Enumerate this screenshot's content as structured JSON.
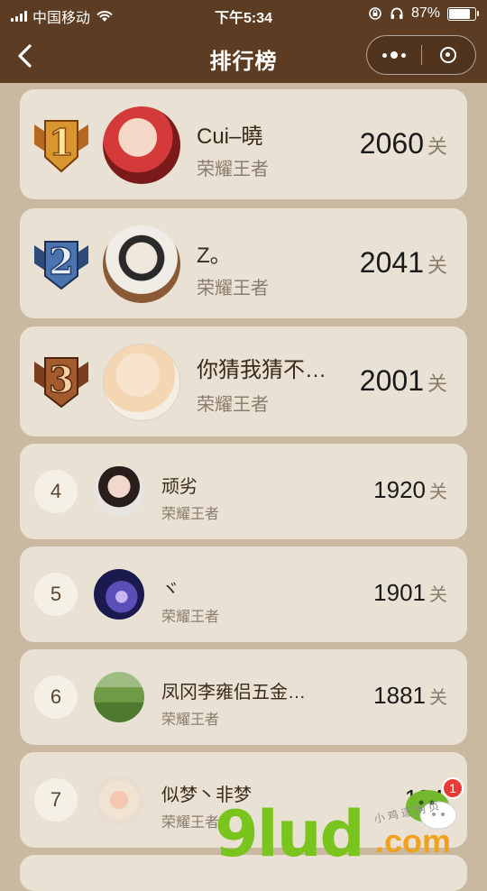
{
  "status_bar": {
    "carrier": "中国移动",
    "time": "下午5:34",
    "battery": "87%",
    "battery_level": 0.87
  },
  "nav": {
    "title": "排行榜"
  },
  "rankings": [
    {
      "rank": "1",
      "name": "Cui–曉",
      "title": "荣耀王者",
      "score": "2060",
      "unit": "关",
      "medal": "gold-1-medal-icon",
      "avatar": "baby-avatar"
    },
    {
      "rank": "2",
      "name": "Z。",
      "title": "荣耀王者",
      "score": "2041",
      "unit": "关",
      "medal": "silver-2-medal-icon",
      "avatar": "boy-sunglasses-avatar"
    },
    {
      "rank": "3",
      "name": "你猜我猜不…",
      "title": "荣耀王者",
      "score": "2001",
      "unit": "关",
      "medal": "bronze-3-medal-icon",
      "avatar": "cartoon-baby-avatar"
    },
    {
      "rank": "4",
      "name": "顽劣",
      "title": "荣耀王者",
      "score": "1920",
      "unit": "关",
      "avatar": "girl-portrait-avatar"
    },
    {
      "rank": "5",
      "name": "ヾ",
      "title": "荣耀王者",
      "score": "1901",
      "unit": "关",
      "avatar": "whale-galaxy-avatar"
    },
    {
      "rank": "6",
      "name": "凤冈李雍侣五金…",
      "title": "荣耀王者",
      "score": "1881",
      "unit": "关",
      "avatar": "landscape-avatar"
    },
    {
      "rank": "7",
      "name": "似梦丶非梦",
      "title": "荣耀王者",
      "score": "184",
      "unit": "",
      "avatar": "cartoon-couple-avatar"
    }
  ],
  "watermark": {
    "text": "9lud",
    "suffix": ".com",
    "badge_count": "1",
    "small_text": "小 鸡 逐 网 页"
  },
  "colors": {
    "header_bg": "#5c3c22",
    "page_bg": "#c9b9a0",
    "card_bg": "#e9e1d3",
    "name_text": "#3a2a1a",
    "subtitle_text": "#8b7d6e",
    "watermark_green": "#7ac41e",
    "watermark_orange": "#f2a11c",
    "badge_red": "#e83b36"
  }
}
